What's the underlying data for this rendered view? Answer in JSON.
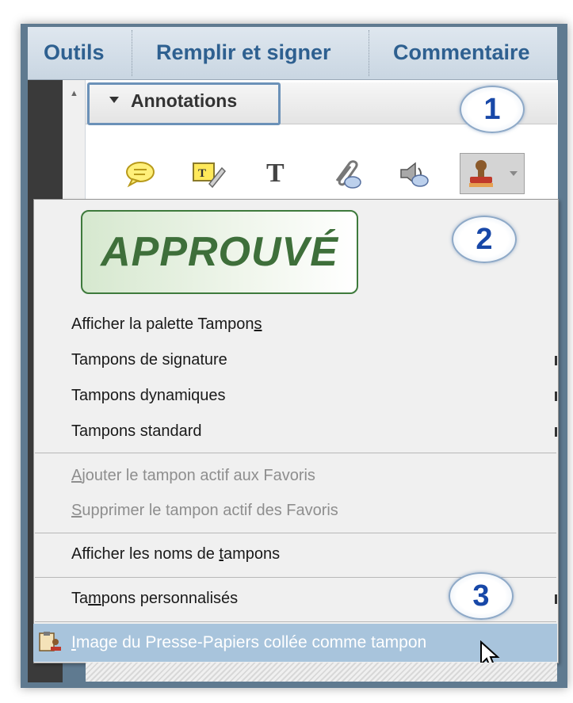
{
  "tabs": [
    {
      "label": "Outils"
    },
    {
      "label": "Remplir et signer"
    },
    {
      "label": "Commentaire"
    }
  ],
  "panel": {
    "section_title": "Annotations",
    "tools": [
      {
        "icon": "sticky-note-icon"
      },
      {
        "icon": "highlight-text-icon"
      },
      {
        "icon": "text-tool-icon",
        "glyph": "T"
      },
      {
        "icon": "attach-file-icon"
      },
      {
        "icon": "record-audio-icon"
      },
      {
        "icon": "stamp-icon"
      }
    ]
  },
  "badges": [
    "1",
    "2",
    "3"
  ],
  "stamp_preview": {
    "text": "APPROUVÉ",
    "color": "#3e6f3a"
  },
  "menu": {
    "show_palette": {
      "before": "Afficher la palette Tampon",
      "accel": "s",
      "after": ""
    },
    "signature_stamps": "Tampons de signature",
    "dynamic_stamps": "Tampons dynamiques",
    "standard_stamps": "Tampons standard",
    "add_favorite": {
      "before": "",
      "accel": "A",
      "after": "jouter le tampon actif aux Favoris"
    },
    "remove_favorite": {
      "before": "",
      "accel": "S",
      "after": "upprimer le tampon actif des Favoris"
    },
    "show_names": {
      "before": "Afficher les noms de ",
      "accel": "t",
      "after": "ampons"
    },
    "custom_stamps": {
      "before": "Ta",
      "accel": "m",
      "after": "pons personnalisés"
    },
    "paste_clipboard": {
      "before": "",
      "accel": "I",
      "after": "mage du Presse-Papiers collée comme tampon"
    }
  },
  "colors": {
    "accent": "#2e6090",
    "highlight": "#a8c4dc",
    "badge_text": "#1848a8"
  }
}
